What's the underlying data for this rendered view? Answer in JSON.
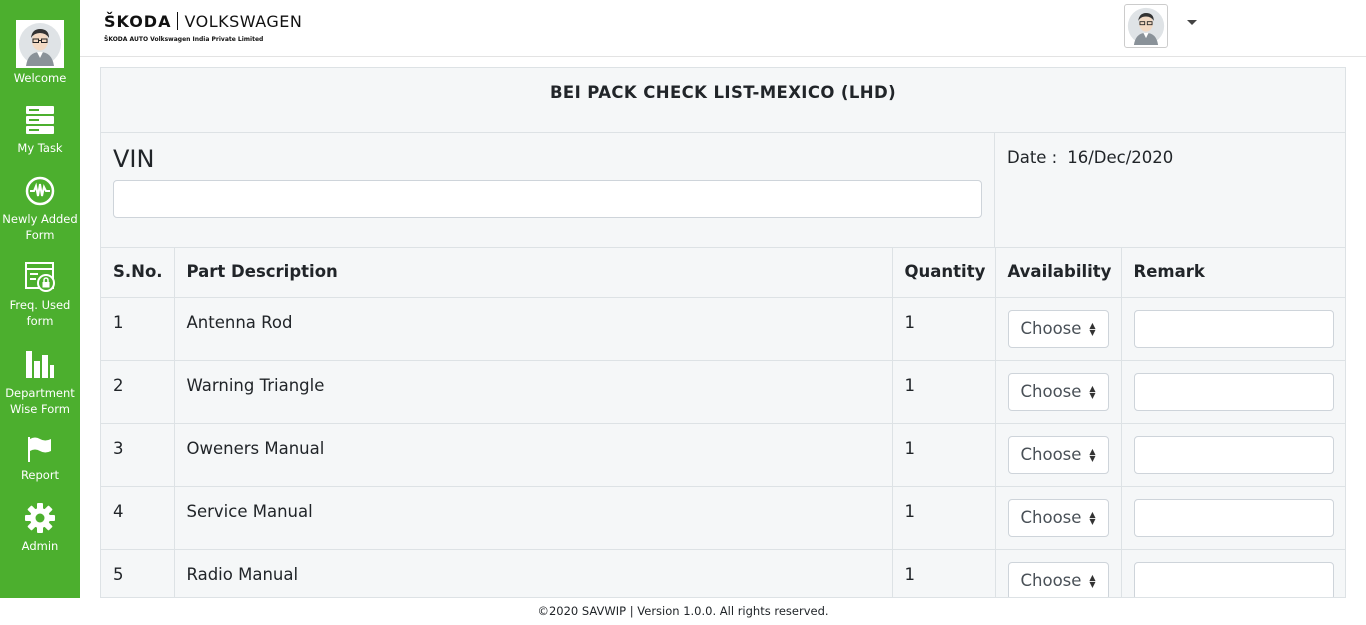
{
  "sidebar": {
    "items": [
      {
        "label": "Welcome",
        "icon": "user-avatar-icon"
      },
      {
        "label": "My Task",
        "icon": "server-stack-icon"
      },
      {
        "label": "Newly Added Form",
        "icon": "pulse-circle-icon"
      },
      {
        "label": "Freq. Used form",
        "icon": "locked-form-icon"
      },
      {
        "label": "Department Wise Form",
        "icon": "bar-chart-icon"
      },
      {
        "label": "Report",
        "icon": "flag-icon"
      },
      {
        "label": "Admin",
        "icon": "gear-icon"
      }
    ],
    "color": "#4caf2e"
  },
  "header": {
    "brand_left": "ŠKODA",
    "brand_right": "VOLKSWAGEN",
    "brand_sub": "ŠKODA AUTO Volkswagen India Private Limited"
  },
  "form": {
    "title": "BEI PACK CHECK LIST-MEXICO (LHD)",
    "vin_label": "VIN",
    "vin_value": "",
    "date_label": "Date :",
    "date_value": "16/Dec/2020"
  },
  "table": {
    "headers": [
      "S.No.",
      "Part Description",
      "Quantity",
      "Availability",
      "Remark"
    ],
    "select_placeholder": "Choose",
    "rows": [
      {
        "sno": "1",
        "desc": "Antenna Rod",
        "qty": "1"
      },
      {
        "sno": "2",
        "desc": "Warning Triangle",
        "qty": "1"
      },
      {
        "sno": "3",
        "desc": "Oweners Manual",
        "qty": "1"
      },
      {
        "sno": "4",
        "desc": "Service Manual",
        "qty": "1"
      },
      {
        "sno": "5",
        "desc": "Radio Manual",
        "qty": "1"
      }
    ]
  },
  "footer": {
    "text": "©2020 SAVWIP | Version 1.0.0. All rights reserved."
  }
}
